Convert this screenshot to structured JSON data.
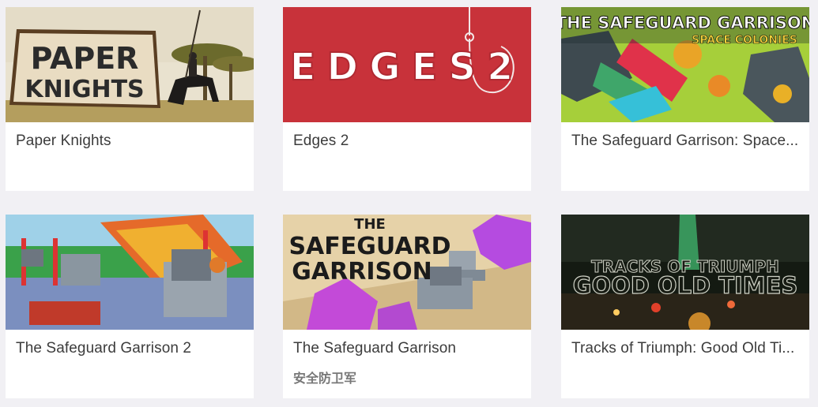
{
  "games": [
    {
      "title": "Paper Knights",
      "banner": [
        "PAPER",
        "KNIGHTS"
      ]
    },
    {
      "title": "Edges 2",
      "banner": [
        "EDGES2"
      ]
    },
    {
      "title": "The Safeguard Garrison: Space...",
      "banner": [
        "THE SAFEGUARD GARRISON",
        "SPACE COLONIES"
      ]
    },
    {
      "title": "The Safeguard Garrison 2",
      "banner": []
    },
    {
      "title": "The Safeguard Garrison",
      "subtitle": "安全防卫军",
      "banner": [
        "THE",
        "SAFEGUARD",
        "GARRISON"
      ]
    },
    {
      "title": "Tracks of Triumph: Good Old Ti...",
      "banner": [
        "TRACKS OF TRIUMPH",
        "GOOD OLD TIMES"
      ]
    }
  ]
}
